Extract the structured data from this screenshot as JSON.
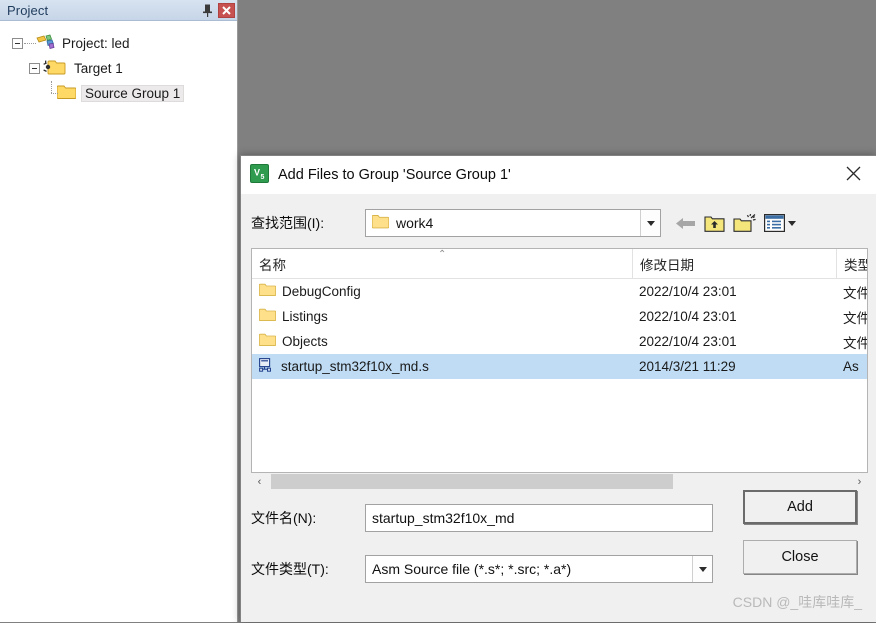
{
  "project_panel": {
    "title": "Project",
    "pin_icon": "pin-icon",
    "close_icon": "close-icon",
    "tree": [
      {
        "label": "Project: led",
        "icon": "project-icon",
        "level": 0,
        "expander": "minus"
      },
      {
        "label": "Target 1",
        "icon": "target-folder-icon",
        "level": 1,
        "expander": "minus"
      },
      {
        "label": "Source Group 1",
        "icon": "folder-icon",
        "level": 2,
        "expander": "none",
        "selected": true
      }
    ]
  },
  "dialog": {
    "app_icon": "keil-uvision-icon",
    "title": "Add Files to Group 'Source Group 1'",
    "close_icon": "close-icon",
    "lookin": {
      "label": "查找范围(I):",
      "value": "work4",
      "folder_icon": "folder-icon",
      "dropdown_icon": "chevron-down-icon"
    },
    "nav_buttons": [
      {
        "name": "back-button",
        "icon": "arrow-left-icon"
      },
      {
        "name": "up-one-level-button",
        "icon": "folder-up-icon"
      },
      {
        "name": "new-folder-button",
        "icon": "new-folder-icon"
      },
      {
        "name": "views-button",
        "icon": "views-icon"
      }
    ],
    "filelist": {
      "sort_indicator": "⌃",
      "columns": [
        "名称",
        "修改日期",
        "类型"
      ],
      "rows": [
        {
          "name": "DebugConfig",
          "date": "2022/10/4 23:01",
          "type": "文件",
          "icon": "folder-icon",
          "selected": false
        },
        {
          "name": "Listings",
          "date": "2022/10/4 23:01",
          "type": "文件",
          "icon": "folder-icon",
          "selected": false
        },
        {
          "name": "Objects",
          "date": "2022/10/4 23:01",
          "type": "文件",
          "icon": "folder-icon",
          "selected": false
        },
        {
          "name": "startup_stm32f10x_md.s",
          "date": "2014/3/21 11:29",
          "type": "As",
          "icon": "asm-file-icon",
          "selected": true
        }
      ]
    },
    "scrollbar": {
      "left_arrow": "‹",
      "right_arrow": "›"
    },
    "filename": {
      "label": "文件名(N):",
      "value": "startup_stm32f10x_md"
    },
    "filetype": {
      "label": "文件类型(T):",
      "value": "Asm Source file (*.s*; *.src; *.a*)",
      "dropdown_icon": "chevron-down-icon"
    },
    "add_button": "Add",
    "close_button": "Close"
  },
  "watermark": "CSDN @_哇库哇库_",
  "colors": {
    "selection": "#bfdcf4",
    "panel_title_bg": "#cfdcec",
    "close_btn_red": "#c75050",
    "desktop_gray": "#808080",
    "folder_yellow": "#ffd966"
  }
}
